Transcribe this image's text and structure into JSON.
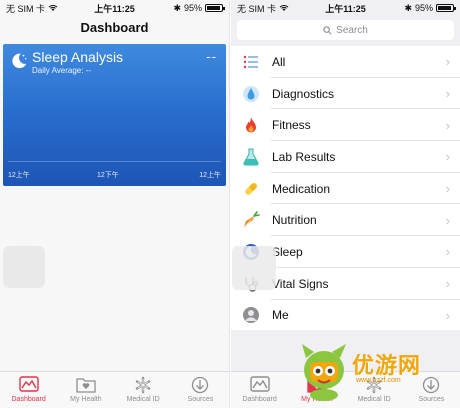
{
  "left": {
    "status": {
      "carrier": "无 SIM 卡",
      "time": "上午11:25",
      "battery": "95%"
    },
    "title": "Dashboard",
    "card": {
      "title": "Sleep Analysis",
      "value": "--",
      "subtitle": "Daily Average: --",
      "ticks": [
        "12上午",
        "12下午",
        "12上午"
      ]
    },
    "tabs": [
      {
        "label": "Dashboard",
        "icon": "dashboard-icon",
        "active": true
      },
      {
        "label": "My Health",
        "icon": "folder-heart-icon",
        "active": false
      },
      {
        "label": "Medical ID",
        "icon": "medical-star-icon",
        "active": false
      },
      {
        "label": "Sources",
        "icon": "download-icon",
        "active": false
      }
    ]
  },
  "right": {
    "status": {
      "carrier": "无 SIM 卡",
      "time": "上午11:25",
      "battery": "95%"
    },
    "search_placeholder": "Search",
    "items": [
      {
        "label": "All",
        "icon": "list-icon"
      },
      {
        "label": "Diagnostics",
        "icon": "drop-icon"
      },
      {
        "label": "Fitness",
        "icon": "flame-icon"
      },
      {
        "label": "Lab Results",
        "icon": "flask-icon"
      },
      {
        "label": "Medication",
        "icon": "pill-icon"
      },
      {
        "label": "Nutrition",
        "icon": "carrot-icon"
      },
      {
        "label": "Sleep",
        "icon": "moon-icon"
      },
      {
        "label": "Vital Signs",
        "icon": "stethoscope-icon"
      },
      {
        "label": "Me",
        "icon": "person-icon"
      }
    ],
    "tabs": [
      {
        "label": "Dashboard",
        "icon": "dashboard-icon",
        "active": false
      },
      {
        "label": "My Health",
        "icon": "folder-heart-icon",
        "active": true
      },
      {
        "label": "Medical ID",
        "icon": "medical-star-icon",
        "active": false
      },
      {
        "label": "Sources",
        "icon": "download-icon",
        "active": false
      }
    ]
  },
  "watermark": {
    "text": "优游网",
    "sub": "www.uzzf.com"
  },
  "colors": {
    "accent": "#e5334a",
    "card_blue": "#2a6fce"
  }
}
